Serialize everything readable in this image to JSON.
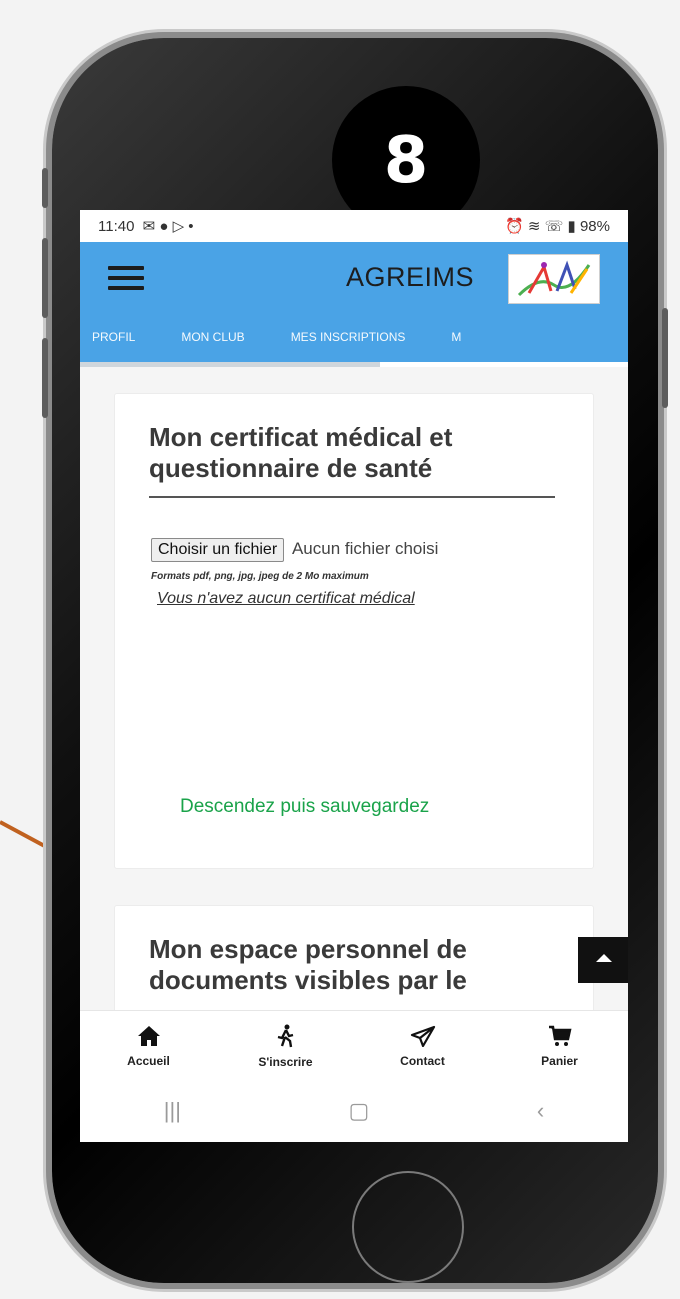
{
  "step_badge": "8",
  "status": {
    "time": "11:40",
    "left_icons": "✉ ● ▷ •",
    "right_icons": "⏰ ≋ ☏ ▮",
    "battery": "98%"
  },
  "appbar": {
    "title": "AGREIMS"
  },
  "tabs": [
    "PROFIL",
    "MON CLUB",
    "MES INSCRIPTIONS",
    "M"
  ],
  "card1": {
    "title": "Mon certificat médical et questionnaire de santé",
    "choose_button": "Choisir un fichier",
    "no_file": "Aucun fichier choisi",
    "formats": "Formats pdf, png, jpg, jpeg de 2 Mo maximum",
    "no_certificate_link": "Vous n'avez aucun certificat médical"
  },
  "note": "Descendez puis sauvegardez",
  "card2": {
    "title": "Mon espace personnel de documents visibles par le"
  },
  "bottom_nav": [
    {
      "label": "Accueil",
      "icon": "home-icon"
    },
    {
      "label": "S'inscrire",
      "icon": "walker-icon"
    },
    {
      "label": "Contact",
      "icon": "send-icon"
    },
    {
      "label": "Panier",
      "icon": "cart-icon"
    }
  ],
  "colors": {
    "appbar": "#4aa3e6",
    "note": "#1aa34a",
    "arrow": "#c0611f"
  }
}
